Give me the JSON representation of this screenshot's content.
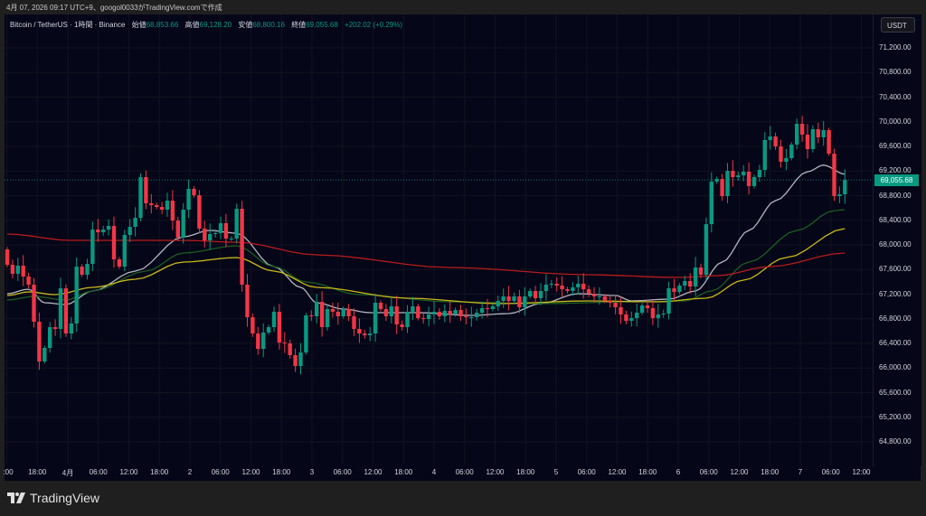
{
  "caption": "4月 07, 2026 09:17 UTC+9、googol0033がTradingView.comで作成",
  "legend": {
    "symbol": "Bitcoin / TetherUS · 1時間 · Binance",
    "open_label": "始値",
    "open": "68,853.66",
    "high_label": "高値",
    "high": "69,128.20",
    "low_label": "安値",
    "low": "68,800.16",
    "close_label": "終値",
    "close": "69,055.68",
    "change": "+202.02 (+0.29%)"
  },
  "currency_button": "USDT",
  "current_price_label": "69,055.68",
  "brand": "TradingView",
  "colors": {
    "up": "#089981",
    "down": "#f23645",
    "ma_fast": "#b2b5be",
    "ma_mid": "#1b5e20",
    "ma_slow": "#c8b81a",
    "ma_long": "#b71c1c"
  },
  "chart_data": {
    "type": "candlestick",
    "symbol": "BTCUSDT",
    "interval": "1h",
    "ylim": [
      64600,
      71500
    ],
    "current_price": 69055.68,
    "price_ticks": [
      "71,200.00",
      "70,800.00",
      "70,400.00",
      "70,000.00",
      "69,600.00",
      "69,200.00",
      "68,800.00",
      "68,400.00",
      "68,000.00",
      "67,600.00",
      "67,200.00",
      "66,800.00",
      "66,400.00",
      "66,000.00",
      "65,600.00",
      "65,200.00",
      "64,800.00"
    ],
    "price_tick_values": [
      71200,
      70800,
      70400,
      70000,
      69600,
      69200,
      68800,
      68400,
      68000,
      67600,
      67200,
      66800,
      66400,
      66000,
      65600,
      65200,
      64800
    ],
    "time_ticks": [
      ":00",
      "18:00",
      "4月",
      "06:00",
      "12:00",
      "18:00",
      "2",
      "06:00",
      "12:00",
      "18:00",
      "3",
      "06:00",
      "12:00",
      "18:00",
      "4",
      "06:00",
      "12:00",
      "18:00",
      "5",
      "06:00",
      "12:00",
      "18:00",
      "6",
      "06:00",
      "12:00",
      "18:00",
      "7",
      "06:00",
      "12:00"
    ],
    "time_tick_hours_from_apr1": [
      -12,
      -6,
      0,
      6,
      12,
      18,
      24,
      30,
      36,
      42,
      48,
      54,
      60,
      66,
      72,
      78,
      84,
      90,
      96,
      102,
      108,
      114,
      120,
      126,
      132,
      138,
      144,
      150,
      156
    ],
    "first_open": 67926,
    "closes": [
      67677,
      67530,
      67662,
      67486,
      67354,
      66752,
      66106,
      66326,
      66664,
      66635,
      67295,
      66561,
      66723,
      67647,
      67515,
      67691,
      68249,
      68205,
      68249,
      68308,
      67765,
      67647,
      68161,
      68293,
      68440,
      69101,
      68675,
      68646,
      68616,
      68572,
      68719,
      68396,
      68117,
      68572,
      68910,
      68807,
      68264,
      68073,
      68176,
      68191,
      68352,
      68102,
      68102,
      68587,
      67354,
      66825,
      66561,
      66311,
      66576,
      66664,
      66914,
      66414,
      66400,
      66209,
      66032,
      66253,
      66855,
      66840,
      67075,
      66664,
      66958,
      66914,
      66840,
      66958,
      66840,
      66635,
      66561,
      66532,
      66561,
      67060,
      66958,
      66840,
      67002,
      66708,
      66664,
      66914,
      67002,
      66811,
      66796,
      66870,
      66914,
      66840,
      66928,
      66870,
      66943,
      66840,
      66825,
      66825,
      66899,
      66972,
      66958,
      67002,
      67090,
      67163,
      67090,
      67163,
      66987,
      67163,
      67251,
      67134,
      67251,
      67354,
      67369,
      67339,
      67280,
      67251,
      67310,
      67369,
      67280,
      67207,
      67163,
      67163,
      67090,
      67060,
      66987,
      66870,
      66767,
      66811,
      66899,
      67016,
      66972,
      66811,
      66870,
      66884,
      67295,
      67236,
      67339,
      67413,
      67324,
      67633,
      67515,
      68337,
      69027,
      69071,
      68792,
      69203,
      69101,
      69130,
      69189,
      68954,
      69101,
      69218,
      69703,
      69761,
      69600,
      69350,
      69409,
      69629,
      69967,
      69791,
      69556,
      69879,
      69747,
      69864,
      69482,
      68792,
      68822,
      69055.68
    ],
    "moving_averages": [
      {
        "name": "MA fast",
        "color_key": "ma_fast",
        "points": [
          [
            0,
            67207
          ],
          [
            4,
            67280
          ],
          [
            7,
            67060
          ],
          [
            11,
            67031
          ],
          [
            16,
            67251
          ],
          [
            24,
            67574
          ],
          [
            33,
            68132
          ],
          [
            38,
            68235
          ],
          [
            43,
            68191
          ],
          [
            50,
            67647
          ],
          [
            55,
            67310
          ],
          [
            58,
            67060
          ],
          [
            63,
            66958
          ],
          [
            68,
            66899
          ],
          [
            77,
            66899
          ],
          [
            87,
            66855
          ],
          [
            94,
            66884
          ],
          [
            100,
            67046
          ],
          [
            107,
            67207
          ],
          [
            114,
            67178
          ],
          [
            117,
            67090
          ],
          [
            124,
            67119
          ],
          [
            129,
            67251
          ],
          [
            134,
            67721
          ],
          [
            139,
            68235
          ],
          [
            144,
            68719
          ],
          [
            150,
            69189
          ],
          [
            153,
            69296
          ],
          [
            157,
            69149
          ]
        ]
      },
      {
        "name": "MA mid",
        "color_key": "ma_mid",
        "points": [
          [
            0,
            67104
          ],
          [
            5,
            67163
          ],
          [
            11,
            67104
          ],
          [
            16,
            67251
          ],
          [
            26,
            67574
          ],
          [
            33,
            67868
          ],
          [
            43,
            67985
          ],
          [
            50,
            67647
          ],
          [
            56,
            67398
          ],
          [
            66,
            67192
          ],
          [
            83,
            67075
          ],
          [
            100,
            67046
          ],
          [
            117,
            67075
          ],
          [
            127,
            67090
          ],
          [
            132,
            67251
          ],
          [
            139,
            67721
          ],
          [
            148,
            68235
          ],
          [
            155,
            68557
          ],
          [
            157,
            68572
          ]
        ]
      },
      {
        "name": "MA slow",
        "color_key": "ma_slow",
        "points": [
          [
            0,
            67178
          ],
          [
            4,
            67236
          ],
          [
            9,
            67192
          ],
          [
            16,
            67310
          ],
          [
            24,
            67442
          ],
          [
            33,
            67721
          ],
          [
            43,
            67794
          ],
          [
            50,
            67574
          ],
          [
            58,
            67310
          ],
          [
            75,
            67134
          ],
          [
            92,
            67046
          ],
          [
            109,
            67090
          ],
          [
            122,
            67075
          ],
          [
            131,
            67134
          ],
          [
            138,
            67427
          ],
          [
            146,
            67794
          ],
          [
            157,
            68264
          ]
        ]
      },
      {
        "name": "MA long",
        "color_key": "ma_long",
        "points": [
          [
            0,
            68176
          ],
          [
            12,
            68073
          ],
          [
            33,
            68073
          ],
          [
            43,
            68044
          ],
          [
            58,
            67838
          ],
          [
            83,
            67633
          ],
          [
            109,
            67515
          ],
          [
            126,
            67471
          ],
          [
            133,
            67500
          ],
          [
            143,
            67647
          ],
          [
            157,
            67868
          ]
        ]
      }
    ]
  }
}
